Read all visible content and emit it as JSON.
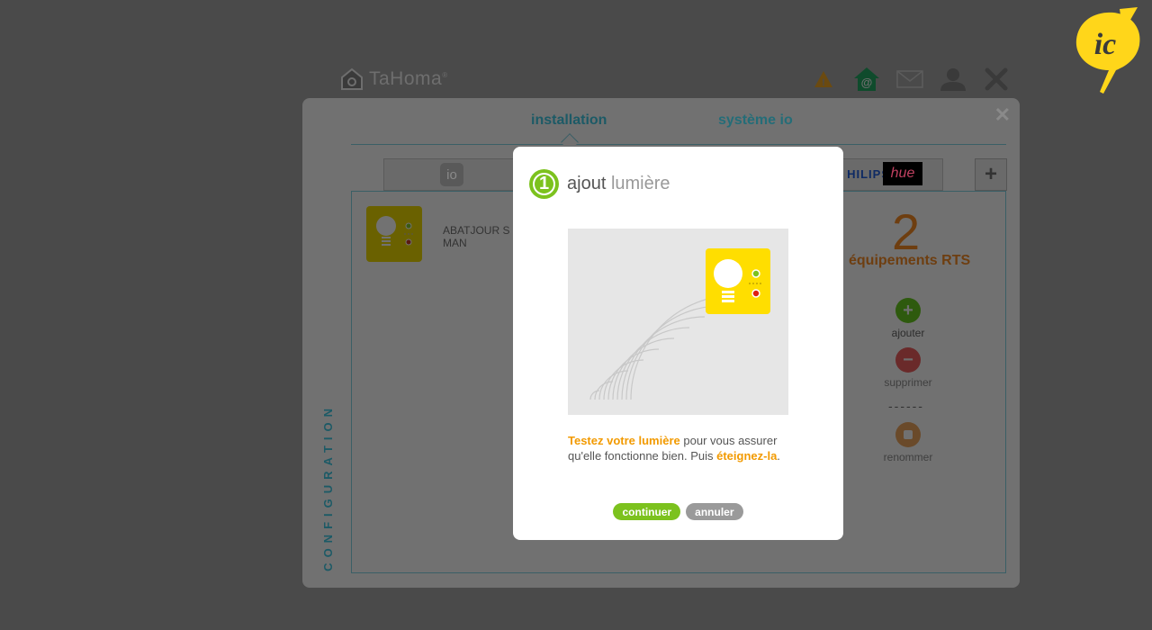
{
  "brand": {
    "name": "TaHoma",
    "reg": "®"
  },
  "top_icons": [
    "alert-icon",
    "home-at-icon",
    "mail-icon",
    "user-icon",
    "close-icon"
  ],
  "window": {
    "tabs": [
      {
        "label": "installation",
        "active": true
      },
      {
        "label": "système io",
        "active": false
      }
    ],
    "subtabs": {
      "io_label": "io",
      "philips_label": "HILIPS",
      "hue_label": "hue",
      "plus_label": "+"
    },
    "device": {
      "name_line1": "ABATJOUR S",
      "name_line2": "MAN"
    },
    "summary": {
      "count": "2",
      "label": "équipements RTS"
    },
    "actions": {
      "add": "ajouter",
      "remove": "supprimer",
      "divider": "------",
      "rename": "renommer"
    },
    "side_label": "CONFIGURATION"
  },
  "modal": {
    "step": "1",
    "title_part1": "ajout",
    "title_part2": "lumière",
    "text_hl1": "Testez votre lumière",
    "text_mid": " pour vous assurer qu'elle fonctionne bien. Puis ",
    "text_hl2": "éteignez-la",
    "text_end": ".",
    "continue_label": "continuer",
    "cancel_label": "annuler"
  },
  "colors": {
    "accent_green": "#7cc21e",
    "accent_orange": "#f29a00",
    "teal": "#1c5a66",
    "bulb_yellow": "#ffde00"
  }
}
